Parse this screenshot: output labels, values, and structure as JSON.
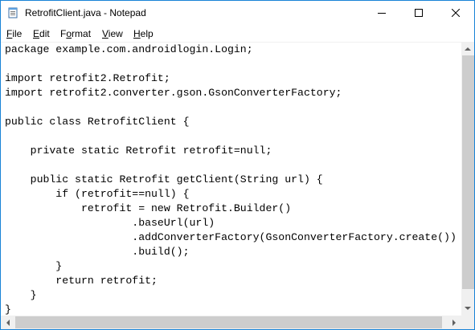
{
  "window": {
    "title": "RetrofitClient.java - Notepad",
    "accent": "#1883d7"
  },
  "menu": {
    "file": {
      "mnemonic": "F",
      "rest": "ile"
    },
    "edit": {
      "mnemonic": "E",
      "rest": "dit"
    },
    "format": {
      "pre": "F",
      "mnemonic": "o",
      "rest": "rmat"
    },
    "view": {
      "mnemonic": "V",
      "rest": "iew"
    },
    "help": {
      "mnemonic": "H",
      "rest": "elp"
    }
  },
  "editor": {
    "lines": [
      "package example.com.androidlogin.Login;",
      "",
      "import retrofit2.Retrofit;",
      "import retrofit2.converter.gson.GsonConverterFactory;",
      "",
      "public class RetrofitClient {",
      "",
      "    private static Retrofit retrofit=null;",
      "",
      "    public static Retrofit getClient(String url) {",
      "        if (retrofit==null) {",
      "            retrofit = new Retrofit.Builder()",
      "                    .baseUrl(url)",
      "                    .addConverterFactory(GsonConverterFactory.create())",
      "                    .build();",
      "        }",
      "        return retrofit;",
      "    }",
      "}"
    ]
  },
  "icons": {
    "app": "notepad-icon",
    "minimize": "minimize-icon",
    "maximize": "maximize-icon",
    "close": "close-icon"
  }
}
